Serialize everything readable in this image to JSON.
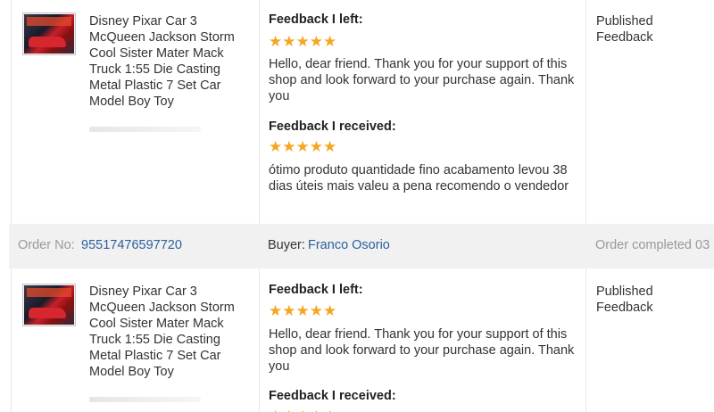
{
  "orders": [
    {
      "product": {
        "title": "Disney Pixar Car 3 McQueen Jackson Storm Cool Sister Mater Mack Truck 1:55 Die Casting Metal Plastic 7 Set Car Model Boy Toy"
      },
      "feedback_left": {
        "label": "Feedback I left:",
        "stars": "★★★★★",
        "text": "Hello, dear friend. Thank you for your support of this shop and look forward to your purchase again. Thank you"
      },
      "feedback_received": {
        "label": "Feedback I received:",
        "stars": "★★★★★",
        "text": "ótimo produto quantidade fino acabamento levou 38 dias úteis mais valeu a pena recomendo o vendedor"
      },
      "status": "Published Feedback"
    },
    {
      "product": {
        "title": "Disney Pixar Car 3 McQueen Jackson Storm Cool Sister Mater Mack Truck 1:55 Die Casting Metal Plastic 7 Set Car Model Boy Toy"
      },
      "feedback_left": {
        "label": "Feedback I left:",
        "stars": "★★★★★",
        "text": "Hello, dear friend. Thank you for your support of this shop and look forward to your purchase again. Thank you"
      },
      "feedback_received": {
        "label": "Feedback I received:",
        "stars": "★★★★★"
      },
      "status": "Published Feedback"
    }
  ],
  "order_bar": {
    "order_no_label": "Order No:",
    "order_no": "95517476597720",
    "buyer_label": "Buyer:",
    "buyer_name": "Franco Osorio",
    "completed_text": "Order completed 03"
  },
  "colors": {
    "star": "#f5a623",
    "link": "#2c5f9e",
    "bar_bg": "#f1f1f1"
  }
}
